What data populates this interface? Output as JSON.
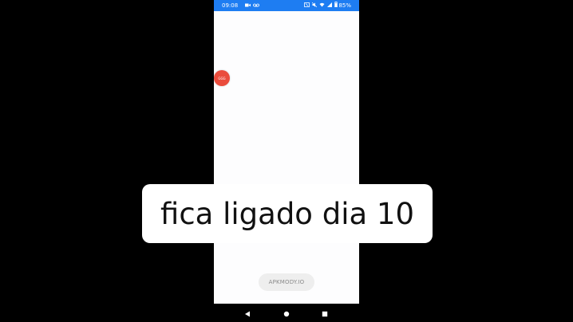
{
  "status_bar": {
    "time": "09:08",
    "battery": "85%",
    "color": "#1e7df2"
  },
  "floating_bubble": {
    "label": "GGG",
    "color": "#ea4c3c"
  },
  "watermark": {
    "label": "APKMODY.IO"
  },
  "caption": {
    "text": "fica ligado dia 10"
  },
  "nav_bar": {
    "back_icon": "back-triangle-icon",
    "home_icon": "home-circle-icon",
    "recents_icon": "recents-square-icon"
  }
}
